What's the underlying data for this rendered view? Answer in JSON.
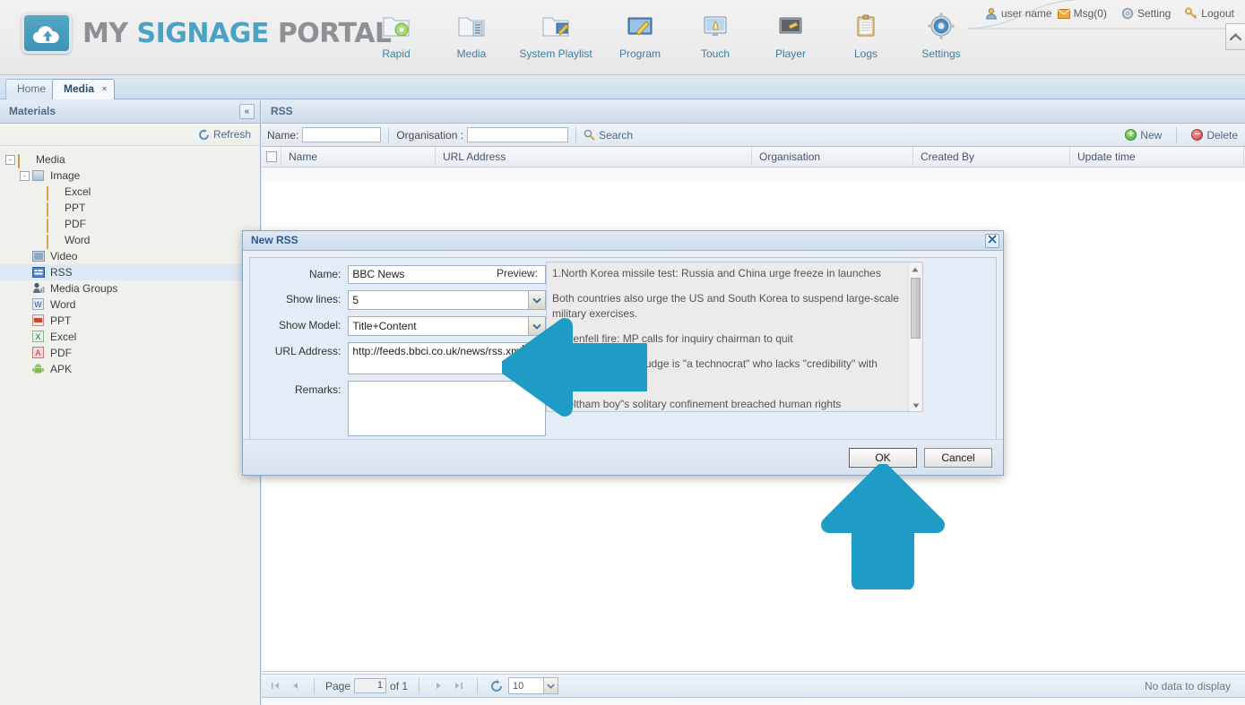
{
  "header": {
    "logo": {
      "part1": "MY ",
      "part2": "SIGNAGE ",
      "part3": "PORTAL",
      "icon": "cloud-upload-logo"
    },
    "nav": [
      {
        "label": "Rapid",
        "icon": "rapid-folder-icon"
      },
      {
        "label": "Media",
        "icon": "media-folder-icon"
      },
      {
        "label": "System Playlist",
        "icon": "system-playlist-icon"
      },
      {
        "label": "Program",
        "icon": "program-icon"
      },
      {
        "label": "Touch",
        "icon": "touch-monitor-icon"
      },
      {
        "label": "Player",
        "icon": "player-screen-icon"
      },
      {
        "label": "Logs",
        "icon": "logs-clipboard-icon"
      },
      {
        "label": "Settings",
        "icon": "settings-gear-icon"
      }
    ],
    "user": {
      "name": "user name",
      "msg": "Msg(0)",
      "setting": "Setting",
      "logout": "Logout"
    }
  },
  "tabs": [
    {
      "label": "Home",
      "active": false,
      "closable": false
    },
    {
      "label": "Media",
      "active": true,
      "closable": true,
      "close": "×"
    }
  ],
  "sidebar": {
    "title": "Materials",
    "collapse_label": "«",
    "refresh_label": "Refresh",
    "tree": [
      {
        "label": "Media",
        "depth": 0,
        "expander": "-",
        "icon": "folder-open-icon",
        "selected": false
      },
      {
        "label": "Image",
        "depth": 1,
        "expander": "-",
        "icon": "image-icon",
        "selected": false
      },
      {
        "label": "Excel",
        "depth": 2,
        "expander": "",
        "icon": "folder-icon",
        "selected": false
      },
      {
        "label": "PPT",
        "depth": 2,
        "expander": "",
        "icon": "folder-icon",
        "selected": false
      },
      {
        "label": "PDF",
        "depth": 2,
        "expander": "",
        "icon": "folder-icon",
        "selected": false
      },
      {
        "label": "Word",
        "depth": 2,
        "expander": "",
        "icon": "folder-icon",
        "selected": false
      },
      {
        "label": "Video",
        "depth": 1,
        "expander": "",
        "icon": "video-icon",
        "selected": false
      },
      {
        "label": "RSS",
        "depth": 1,
        "expander": "",
        "icon": "rss-icon",
        "selected": true
      },
      {
        "label": "Media Groups",
        "depth": 1,
        "expander": "",
        "icon": "media-groups-icon",
        "selected": false
      },
      {
        "label": "Word",
        "depth": 1,
        "expander": "",
        "icon": "word-doc-icon",
        "selected": false
      },
      {
        "label": "PPT",
        "depth": 1,
        "expander": "",
        "icon": "ppt-doc-icon",
        "selected": false
      },
      {
        "label": "Excel",
        "depth": 1,
        "expander": "",
        "icon": "excel-doc-icon",
        "selected": false
      },
      {
        "label": "PDF",
        "depth": 1,
        "expander": "",
        "icon": "pdf-doc-icon",
        "selected": false
      },
      {
        "label": "APK",
        "depth": 1,
        "expander": "",
        "icon": "apk-android-icon",
        "selected": false
      }
    ]
  },
  "main": {
    "panel_title": "RSS",
    "search": {
      "name_label": "Name:",
      "name_value": "",
      "org_label": "Organisation :",
      "org_value": "",
      "search_label": "Search"
    },
    "actions": {
      "new_label": "New",
      "delete_label": "Delete"
    },
    "table": {
      "columns": [
        "Name",
        "URL Address",
        "Organisation",
        "Created By",
        "Update time"
      ],
      "rows": [],
      "empty_text": "No data to display"
    },
    "pager": {
      "page_label": "Page",
      "page_value": "1",
      "of_label": "of 1",
      "page_size": "10",
      "first": "|◀",
      "prev": "◀",
      "next": "▶",
      "last": "▶|",
      "refresh_icon": "refresh-icon"
    }
  },
  "dialog": {
    "title": "New RSS",
    "close_label": "×",
    "fields": {
      "name_label": "Name:",
      "name_value": "BBC News",
      "show_lines_label": "Show lines:",
      "show_lines_value": "5",
      "show_model_label": "Show Model:",
      "show_model_value": "Title+Content",
      "url_label": "URL Address:",
      "url_value": "http://feeds.bbci.co.uk/news/rss.xml",
      "remarks_label": "Remarks:",
      "remarks_value": ""
    },
    "preview_label": "Preview:",
    "preview_items": [
      "1.North Korea missile test: Russia and China urge freeze in launches",
      "Both countries also urge the US and South Korea to suspend large-scale military exercises.",
      "2.Grenfell fire: MP calls for inquiry chairman to quit",
      "Local MP says the judge is \"a technocrat\" who lacks \"credibility\" with affected families.",
      "3.Feltham boy\"s solitary confinement breached human rights"
    ],
    "buttons": {
      "ok": "OK",
      "cancel": "Cancel"
    }
  },
  "annotations": {
    "arrow_color": "#1f9cc6",
    "arrow_left": "points-to-url-address-field",
    "arrow_up": "points-to-ok-button"
  }
}
